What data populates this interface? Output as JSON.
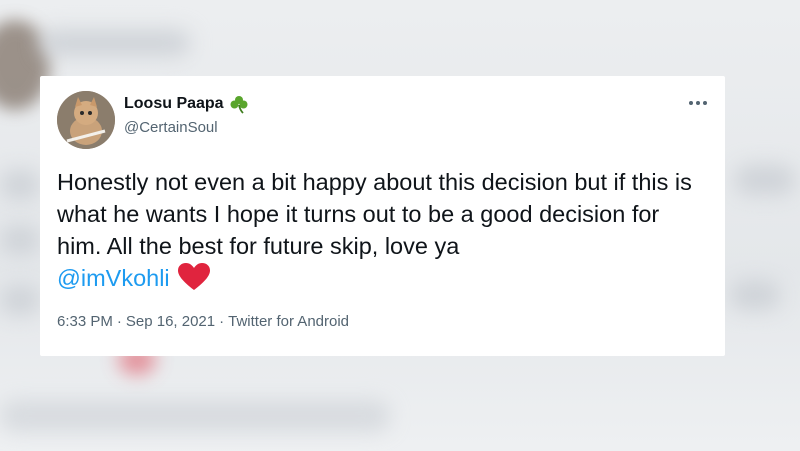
{
  "tweet": {
    "display_name": "Loosu Paapa",
    "name_emoji": "shamrock-icon",
    "handle": "@CertainSoul",
    "text_main": "Honestly not even a bit happy about this decision but if this is what he wants I hope it turns out to be a good decision for him. All the best for future skip, love ya",
    "mention": "@imVkohli",
    "trailing_emoji": "red-heart-icon",
    "time": "6:33 PM",
    "date": "Sep 16, 2021",
    "source": "Twitter for Android",
    "separator": "·"
  },
  "colors": {
    "link": "#1d9bf0",
    "text": "#0f1419",
    "secondary": "#536471",
    "heart": "#e0243e",
    "clover": "#59a52c"
  }
}
